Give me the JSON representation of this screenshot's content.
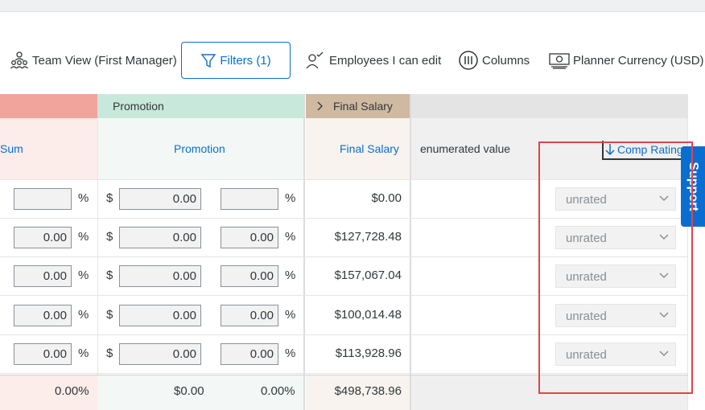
{
  "toolbar": {
    "team_view": "Team View (First Manager)",
    "filters": "Filters (1)",
    "employees_edit": "Employees I can edit",
    "columns": "Columns",
    "planner_currency": "Planner Currency (USD)"
  },
  "groups": {
    "promotion": "Promotion",
    "final_salary": "Final Salary"
  },
  "headers": {
    "sum": "Sum",
    "promotion": "Promotion",
    "final_salary": "Final Salary",
    "enumerated": "enumerated value",
    "comp_rating": "Comp Rating"
  },
  "symbols": {
    "percent": "%",
    "dollar": "$"
  },
  "rows": [
    {
      "pct": "",
      "promo_amt": "0.00",
      "promo_pct": "",
      "final": "$0.00",
      "rating": "unrated"
    },
    {
      "pct": "0.00",
      "promo_amt": "0.00",
      "promo_pct": "0.00",
      "final": "$127,728.48",
      "rating": "unrated"
    },
    {
      "pct": "0.00",
      "promo_amt": "0.00",
      "promo_pct": "0.00",
      "final": "$157,067.04",
      "rating": "unrated"
    },
    {
      "pct": "0.00",
      "promo_amt": "0.00",
      "promo_pct": "0.00",
      "final": "$100,014.48",
      "rating": "unrated"
    },
    {
      "pct": "0.00",
      "promo_amt": "0.00",
      "promo_pct": "0.00",
      "final": "$113,928.96",
      "rating": "unrated"
    }
  ],
  "totals": {
    "pct": "0.00%",
    "promo_amt": "$0.00",
    "promo_pct": "0.00%",
    "final": "$498,738.96"
  },
  "support": "Support",
  "colors": {
    "accent": "#0a6ed1",
    "sum_group": "#f0a49c",
    "sum_bg": "#fcecea",
    "promotion_group": "#c9e8dc",
    "promotion_bg": "#f3f8f6",
    "final_group": "#cfb9a1",
    "final_bg": "#f8f3ee",
    "highlight": "#e2434b"
  }
}
